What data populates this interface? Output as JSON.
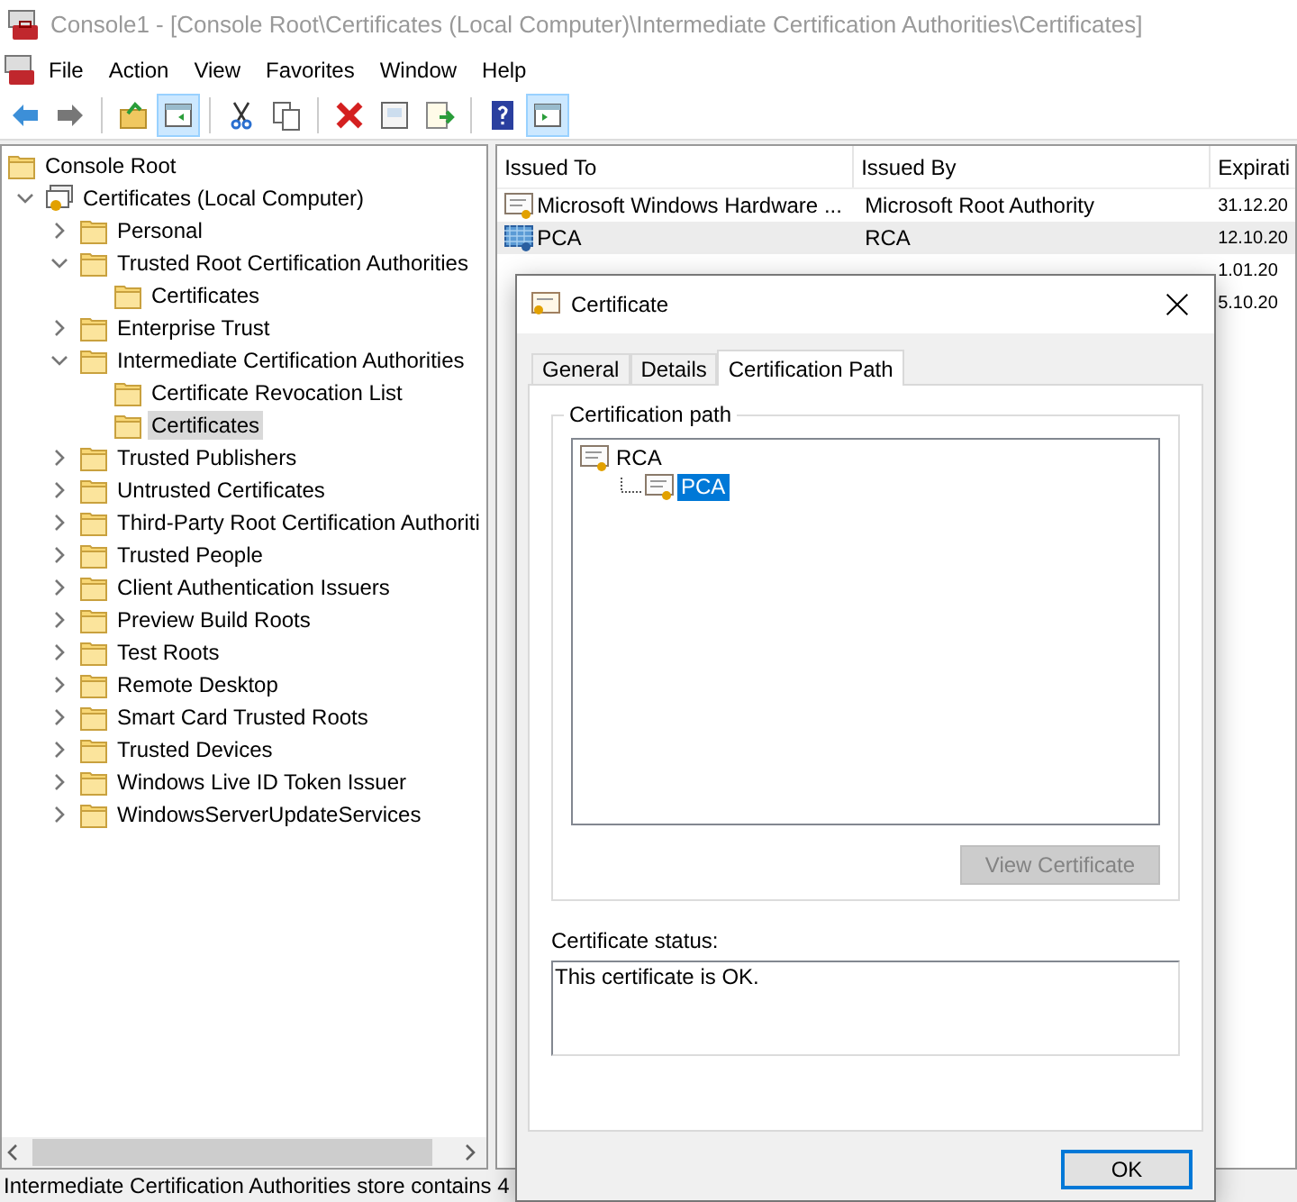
{
  "window": {
    "title": "Console1 - [Console Root\\Certificates (Local Computer)\\Intermediate Certification Authorities\\Certificates]"
  },
  "menu": [
    "File",
    "Action",
    "View",
    "Favorites",
    "Window",
    "Help"
  ],
  "toolbar": [
    {
      "selected": false
    },
    {
      "selected": false
    },
    {
      "selected": false
    },
    {
      "selected": true
    },
    {
      "selected": false
    },
    {
      "selected": false
    },
    {
      "selected": false
    },
    {
      "selected": false
    },
    {
      "selected": false
    },
    {
      "selected": false
    },
    {
      "selected": true
    }
  ],
  "tree": [
    {
      "label": "Console Root",
      "selected": false,
      "children": [
        {
          "label": "Certificates (Local Computer)",
          "selected": false,
          "expanded": true,
          "kind": "store",
          "children": [
            {
              "label": "Personal",
              "selected": false,
              "expanded": false
            },
            {
              "label": "Trusted Root Certification Authorities",
              "selected": false,
              "expanded": true,
              "children": [
                {
                  "label": "Certificates",
                  "selected": false
                }
              ]
            },
            {
              "label": "Enterprise Trust",
              "selected": false,
              "expanded": false
            },
            {
              "label": "Intermediate Certification Authorities",
              "selected": false,
              "expanded": true,
              "children": [
                {
                  "label": "Certificate Revocation List",
                  "selected": false
                },
                {
                  "label": "Certificates",
                  "selected": true
                }
              ]
            },
            {
              "label": "Trusted Publishers",
              "selected": false,
              "expanded": false
            },
            {
              "label": "Untrusted Certificates",
              "selected": false,
              "expanded": false
            },
            {
              "label": "Third-Party Root Certification Authoriti",
              "selected": false,
              "expanded": false
            },
            {
              "label": "Trusted People",
              "selected": false,
              "expanded": false
            },
            {
              "label": "Client Authentication Issuers",
              "selected": false,
              "expanded": false
            },
            {
              "label": "Preview Build Roots",
              "selected": false,
              "expanded": false
            },
            {
              "label": "Test Roots",
              "selected": false,
              "expanded": false
            },
            {
              "label": "Remote Desktop",
              "selected": false,
              "expanded": false
            },
            {
              "label": "Smart Card Trusted Roots",
              "selected": false,
              "expanded": false
            },
            {
              "label": "Trusted Devices",
              "selected": false,
              "expanded": false
            },
            {
              "label": "Windows Live ID Token Issuer",
              "selected": false,
              "expanded": false
            },
            {
              "label": "WindowsServerUpdateServices",
              "selected": false,
              "expanded": false
            }
          ]
        }
      ]
    }
  ],
  "table": {
    "columns": [
      "Issued To",
      "Issued By",
      "Expirati"
    ],
    "rows": [
      {
        "issued_to": "Microsoft Windows Hardware ...",
        "issued_by": "Microsoft Root Authority",
        "expiration": "31.12.20",
        "selected": false
      },
      {
        "issued_to": "PCA",
        "issued_by": "RCA",
        "expiration": "12.10.20",
        "selected": true
      },
      {
        "expiration": "1.01.20",
        "selected": false
      },
      {
        "expiration": "5.10.20",
        "selected": false
      }
    ]
  },
  "status_bar": "Intermediate Certification Authorities store contains 4",
  "dialog": {
    "title": "Certificate",
    "tabs": [
      {
        "label": "General",
        "selected": false
      },
      {
        "label": "Details",
        "selected": false
      },
      {
        "label": "Certification Path",
        "selected": true
      }
    ],
    "group_title": "Certification path",
    "path": [
      {
        "label": "RCA",
        "selected": false,
        "children": [
          {
            "label": "PCA",
            "selected": true
          }
        ]
      }
    ],
    "view_button": {
      "label": "View Certificate",
      "disabled": true
    },
    "status_label": "Certificate status:",
    "status_text": "This certificate is OK.",
    "ok_button": "OK"
  }
}
